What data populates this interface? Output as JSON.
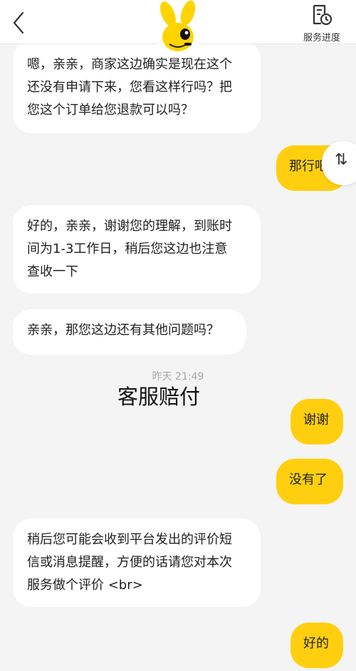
{
  "header": {
    "progress_label": "服务进度",
    "back_icon": "chevron-left-icon",
    "progress_icon": "document-clock-icon",
    "mascot_icon": "yellow-mascot-icon"
  },
  "messages": {
    "m1": {
      "line1": "嗯，亲亲，商家这边确实是现在这个",
      "line2": "还没有申请下来，您看这样行吗？把",
      "line3": "您这个订单给您退款可以吗？"
    },
    "m2": {
      "text": "那行吧"
    },
    "m3": {
      "line1": "好的，亲亲，谢谢您的理解，到账时",
      "line2": "间为1-3工作日，稍后您这边也注意",
      "line3": "查收一下"
    },
    "m4": {
      "text": "亲亲，那您这边还有其他问题吗？"
    },
    "m5": {
      "text": "谢谢"
    },
    "m6": {
      "text": "没有了"
    },
    "m7": {
      "line1": "稍后您可能会收到平台发出的评价短",
      "line2": "信或消息提醒，方便的话请您对本次",
      "line3": "服务做个评价 <br>"
    },
    "m8": {
      "text": "好的"
    }
  },
  "timestamp": "昨天 21:49",
  "caption": "客服赔付",
  "scroll_chip": {
    "glyph": "⇅",
    "icon": "sort-arrows-icon"
  },
  "colors": {
    "accent": "#ffcf0f",
    "background": "#f4f4f4",
    "bubble_left": "#ffffff"
  }
}
